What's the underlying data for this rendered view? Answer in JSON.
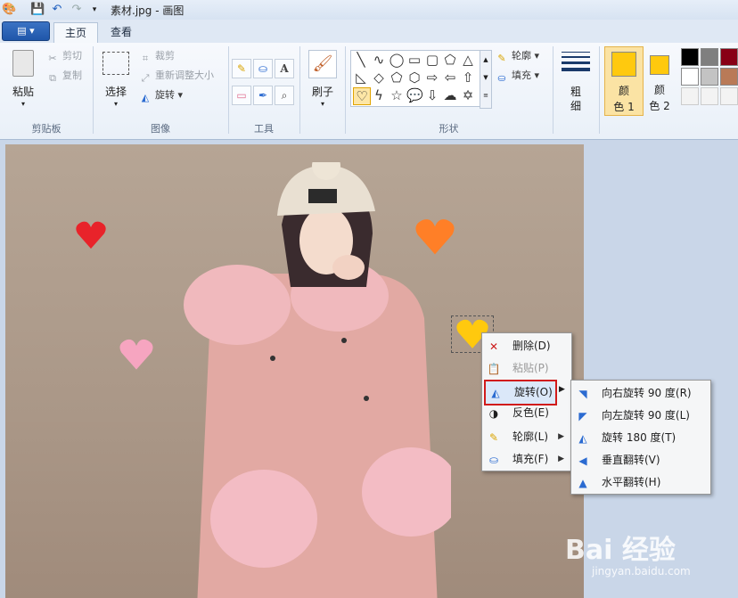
{
  "window": {
    "title": "素材.jpg - 画图"
  },
  "tabs": {
    "file": "▤ ▾",
    "home": "主页",
    "view": "查看"
  },
  "clipboard": {
    "paste": "粘贴",
    "cut": "剪切",
    "copy": "复制",
    "group": "剪贴板"
  },
  "image": {
    "select": "选择",
    "crop": "裁剪",
    "resize": "重新调整大小",
    "rotate": "旋转",
    "group": "图像"
  },
  "tools": {
    "group": "工具"
  },
  "brushes": {
    "label": "刷子"
  },
  "shapes": {
    "outline": "轮廓",
    "fill": "填充",
    "group": "形状"
  },
  "size": {
    "label_1": "粗",
    "label_2": "细"
  },
  "colors": {
    "color1_label_1": "颜",
    "color1_label_2": "色 1",
    "color2_label_1": "颜",
    "color2_label_2": "色 2",
    "color1": "#ffc90e",
    "color2": "#ffc90e",
    "palette": [
      "#000000",
      "#7f7f7f",
      "#880015",
      "#ffffff",
      "#c3c3c3",
      "#b97a57"
    ]
  },
  "context_menu": {
    "items": [
      {
        "label": "删除(D)",
        "icon": "delete-icon"
      },
      {
        "label": "粘贴(P)",
        "icon": "paste-icon",
        "disabled": true
      },
      {
        "label": "旋转(O)",
        "icon": "rotate-icon",
        "highlighted": true
      },
      {
        "label": "反色(E)",
        "icon": "invert-icon"
      },
      {
        "label": "轮廓(L)",
        "icon": "outline-icon"
      },
      {
        "label": "填充(F)",
        "icon": "fill-icon"
      }
    ]
  },
  "rotate_submenu": {
    "items": [
      {
        "label": "向右旋转 90 度(R)",
        "icon": "rotate-right-icon"
      },
      {
        "label": "向左旋转 90 度(L)",
        "icon": "rotate-left-icon"
      },
      {
        "label": "旋转 180 度(T)",
        "icon": "rotate-180-icon"
      },
      {
        "label": "垂直翻转(V)",
        "icon": "flip-vertical-icon"
      },
      {
        "label": "水平翻转(H)",
        "icon": "flip-horizontal-icon"
      }
    ]
  },
  "watermark": {
    "brand": "Bai 经验",
    "url": "jingyan.baidu.com"
  },
  "hearts": {
    "red": "#e8232a",
    "orange": "#ff7f27",
    "pink": "#f6a5c0",
    "yellow": "#ffc90e"
  }
}
